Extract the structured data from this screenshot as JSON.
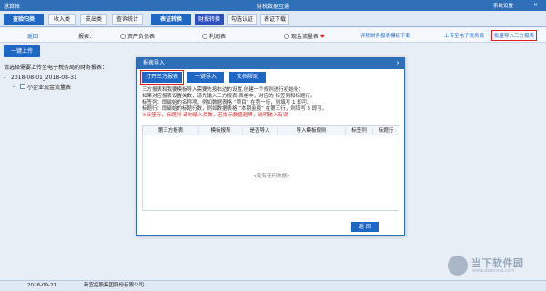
{
  "window": {
    "app_name": "慧算帐",
    "title": "财税数据互通",
    "system_settings": "系统设置"
  },
  "menubar": {
    "tabs": [
      {
        "label": "查验归类",
        "style": "group"
      },
      {
        "label": "收入类",
        "style": "normal"
      },
      {
        "label": "支出类",
        "style": "normal"
      },
      {
        "label": "查询统计",
        "style": "normal"
      },
      {
        "label": "表证转换",
        "style": "group"
      },
      {
        "label": "财报转换",
        "style": "active"
      },
      {
        "label": "勾选认证",
        "style": "normal"
      },
      {
        "label": "表证下载",
        "style": "normal"
      }
    ]
  },
  "toolbar": {
    "back": "返回",
    "report_label": "报表：",
    "radios": [
      {
        "label": "资产负债表"
      },
      {
        "label": "利润表"
      },
      {
        "label": "现金流量表",
        "star": "◆"
      }
    ],
    "links": [
      {
        "label": "评税财务报表模板下载"
      },
      {
        "label": "上传至电子税务局"
      },
      {
        "label": "批量导入三方报表",
        "boxed": true
      }
    ]
  },
  "left": {
    "upload_button": "一键上传",
    "hint": "请选择需要上传至电子税务局的财务报表：",
    "tree": {
      "toggle": "-",
      "root": "2018-08-01_2018-08-31",
      "child_toggle": "-",
      "child": "小企业现金流量表"
    }
  },
  "dialog": {
    "title": "报表导入",
    "close": "×",
    "buttons": [
      {
        "label": "打开三方报表",
        "boxed": true
      },
      {
        "label": "一键导入"
      },
      {
        "label": "文档帮助"
      }
    ],
    "desc": [
      "三方报表和我要模板导入需要先按右边的设置,创建一个规则进行初始化：",
      "如果对应报表设置关数，请先输入三方报表 表格中，对应的 标签列和标题行。",
      "标签列：即磁始的名称项，例如数据表格 “项目” 在第一行，则填写 1 即可。",
      "标题行：即磁始的标题行数，例如数据表格 “本期金额” 在第三行，则填写 3 即可。"
    ],
    "warning": "※标签行，标题列 请勿输入负数，若提示数值越界，说明输入有误",
    "columns": [
      "第三方报表",
      "模板报表",
      "是否导入",
      "导入模板规则",
      "标签列",
      "标题行"
    ],
    "empty_text": "<没有任何数据>",
    "return_button": "返 回"
  },
  "statusbar": {
    "date": "2018-09-21",
    "company": "新宜控股集团股份有限公司"
  },
  "watermark": {
    "name": "当下软件园",
    "url": "www.downxia.com"
  }
}
